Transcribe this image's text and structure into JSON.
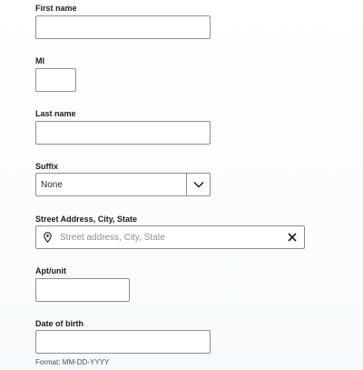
{
  "form": {
    "first_name": {
      "label": "First name",
      "value": ""
    },
    "mi": {
      "label": "MI",
      "value": ""
    },
    "last_name": {
      "label": "Last name",
      "value": ""
    },
    "suffix": {
      "label": "Suffix",
      "selected": "None"
    },
    "address": {
      "label": "Street Address, City, State",
      "placeholder": "Street address, City, State",
      "value": ""
    },
    "apt_unit": {
      "label": "Apt/unit",
      "value": ""
    },
    "dob": {
      "label": "Date of birth",
      "value": "",
      "hint": "Format: MM-DD-YYYY"
    }
  },
  "icons": {
    "suffix_dropdown": "chevron-down-icon",
    "address_pin": "location-pin-icon",
    "address_clear": "close-icon"
  }
}
